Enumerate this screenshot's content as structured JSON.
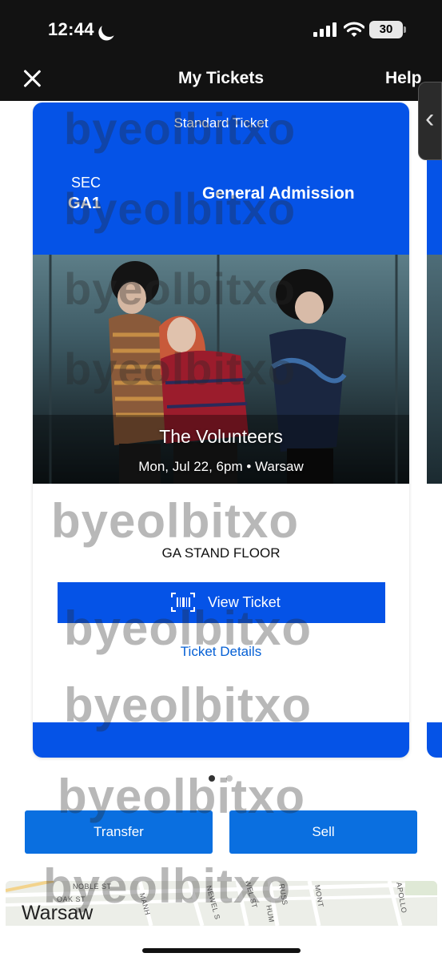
{
  "status_bar": {
    "time": "12:44",
    "battery": "30"
  },
  "header": {
    "title": "My Tickets",
    "help": "Help"
  },
  "ticket": {
    "type": "Standard Ticket",
    "sec_label": "SEC",
    "sec_value": "GA1",
    "admission": "General Admission",
    "event_name": "The Volunteers",
    "event_info": "Mon, Jul 22, 6pm • Warsaw",
    "section": "GA STAND FLOOR",
    "view_ticket": "View Ticket",
    "ticket_details": "Ticket Details"
  },
  "actions": {
    "transfer": "Transfer",
    "sell": "Sell"
  },
  "map": {
    "city": "Warsaw",
    "streets": [
      "NOBLE ST",
      "OAK ST",
      "JEWEL ST",
      "RUSS",
      "MONT",
      "APOLLO",
      "MANH",
      "NEWEL S",
      "HUM"
    ]
  },
  "watermark": "byeolbitxo",
  "colors": {
    "brand_blue": "#0553e7",
    "button_blue": "#0a6fe0",
    "link_blue": "#0560d5"
  }
}
